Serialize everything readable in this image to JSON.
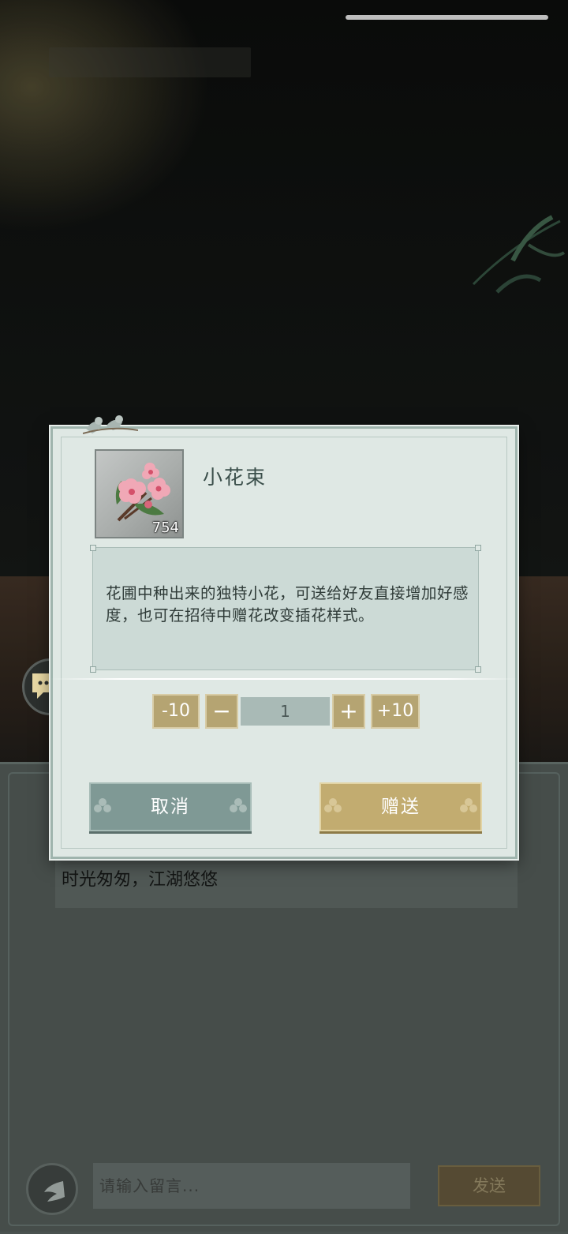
{
  "item": {
    "name": "小花束",
    "count": "754",
    "description": "花圃中种出来的独特小花，可送给好友直接增加好感度，也可在招待中赠花改变插花样式。"
  },
  "quantity": {
    "minus10_label": "-10",
    "minus_label": "−",
    "value": "1",
    "plus_label": "+",
    "plus10_label": "+10"
  },
  "dialog_buttons": {
    "cancel_label": "取消",
    "gift_label": "赠送"
  },
  "chat": {
    "message": "时光匆匆，江湖悠悠",
    "input_placeholder": "请输入留言...",
    "send_label": "发送"
  },
  "icons": {
    "back": "back-arrow-icon",
    "chat_side": "chat-gift-icon",
    "item": "flower-bouquet-icon"
  },
  "colors": {
    "gold_button": "#c2ac70",
    "teal_button": "#7f9995",
    "dialog_bg": "#dfe8e4"
  }
}
